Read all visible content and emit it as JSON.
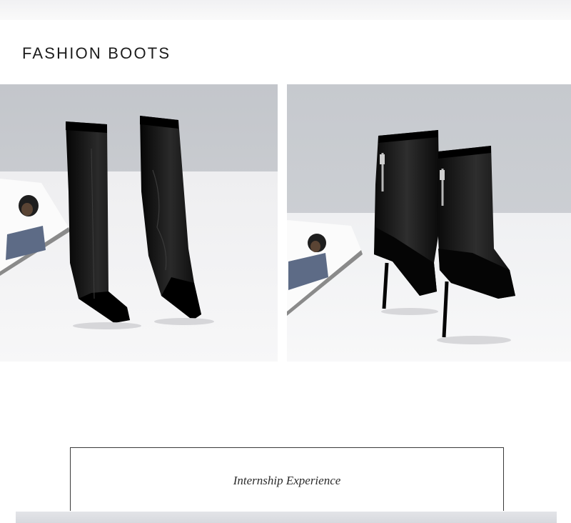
{
  "section": {
    "title": "FASHION BOOTS"
  },
  "photos": [
    {
      "subject": "front view of black mesh pointed-toe heeled ankle boots"
    },
    {
      "subject": "back view of black mesh stiletto ankle boots with zippers"
    }
  ],
  "panel": {
    "heading": "Internship Experience"
  },
  "colors": {
    "title_text": "#1c1c1c",
    "backdrop_wall": "#c7cacf",
    "floor": "#f3f3f5",
    "boot_black": "#0d0d0d"
  }
}
